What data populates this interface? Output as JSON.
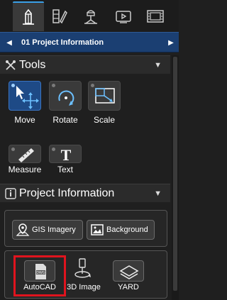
{
  "mode_tabs": [
    {
      "icon": "pencil-icon",
      "active": true
    },
    {
      "icon": "materials-icon",
      "active": false
    },
    {
      "icon": "scene-icon",
      "active": false
    },
    {
      "icon": "video-icon",
      "active": false
    },
    {
      "icon": "film-icon",
      "active": false
    }
  ],
  "project_nav": {
    "title": "01 Project Information"
  },
  "tools_section": {
    "title": "Tools",
    "tools": [
      {
        "label": "Move",
        "icon": "move-icon",
        "selected": true
      },
      {
        "label": "Rotate",
        "icon": "rotate-icon",
        "selected": false
      },
      {
        "label": "Scale",
        "icon": "scale-icon",
        "selected": false
      },
      {
        "label": "Measure",
        "icon": "ruler-icon",
        "selected": false
      },
      {
        "label": "Text",
        "icon": "text-icon",
        "selected": false
      }
    ]
  },
  "project_section": {
    "title": "Project Information",
    "buttons": [
      {
        "label": "GIS Imagery",
        "icon": "map-pin-icon"
      },
      {
        "label": "Background",
        "icon": "image-icon"
      }
    ],
    "imports": [
      {
        "label": "AutoCAD",
        "icon": "dwg-file-icon",
        "highlighted": true
      },
      {
        "label": "3D Image",
        "icon": "3d-image-icon",
        "highlighted": false
      },
      {
        "label": "YARD",
        "icon": "yard-icon",
        "highlighted": false
      }
    ]
  },
  "colors": {
    "accent": "#3aa0e8",
    "nav_blue": "#1b3f72",
    "selected_tool": "#1e4a86",
    "highlight": "#e0141e"
  }
}
